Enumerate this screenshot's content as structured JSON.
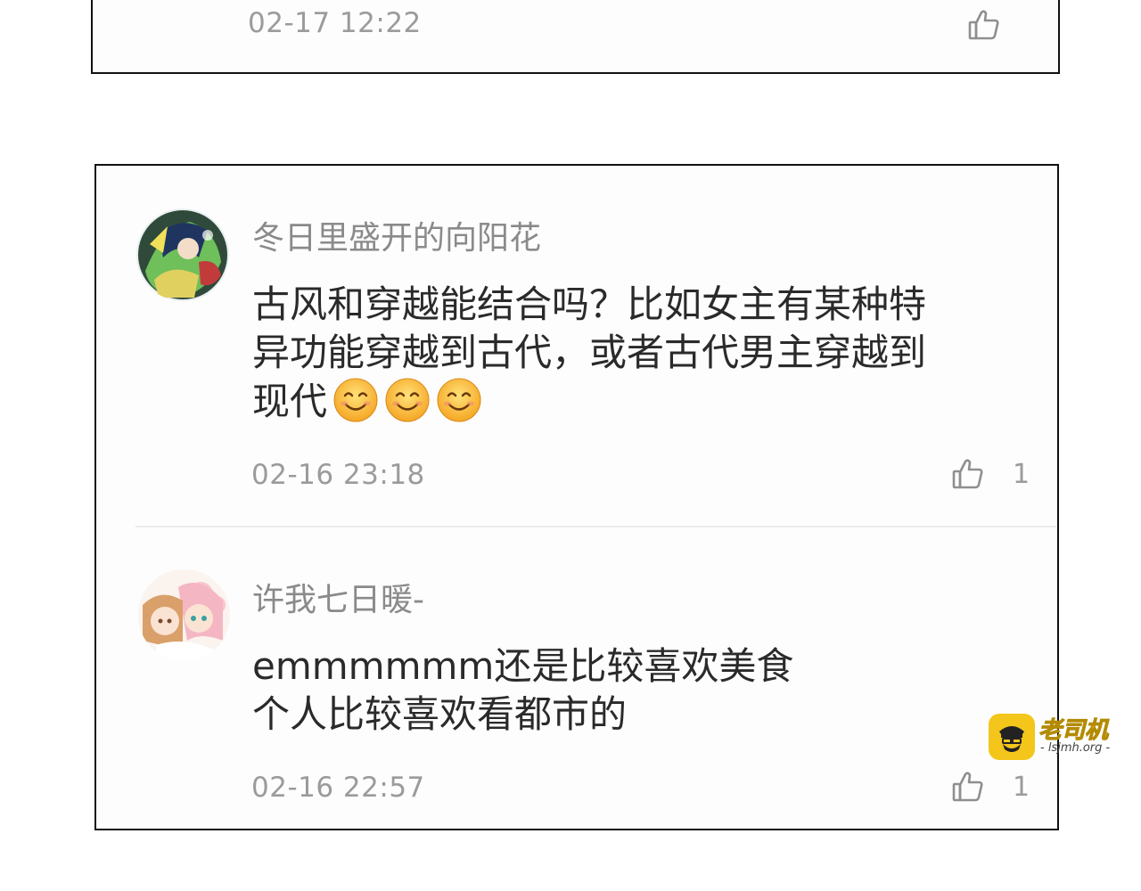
{
  "top_comment": {
    "timestamp": "02-17 12:22",
    "like_icon": "thumbs-up-icon"
  },
  "comments": [
    {
      "username": "冬日里盛开的向阳花",
      "avatar_icon": "anime-avatar",
      "text_lines": [
        "古风和穿越能结合吗？比如女主有某种特",
        "异功能穿越到古代，或者古代男主穿越到",
        "现代"
      ],
      "emoji_icon": "smiling-face-emoji",
      "emoji_count": 3,
      "timestamp": "02-16 23:18",
      "likes": "1",
      "like_icon": "thumbs-up-icon"
    },
    {
      "username": "许我七日暖-",
      "avatar_icon": "anime-avatar",
      "text_lines": [
        "emmmmmm还是比较喜欢美食",
        "个人比较喜欢看都市的"
      ],
      "timestamp": "02-16 22:57",
      "likes": "1",
      "like_icon": "thumbs-up-icon"
    }
  ],
  "watermark": {
    "title": "老司机",
    "url": "- lsjmh.org -",
    "color": "#f4c51a"
  }
}
